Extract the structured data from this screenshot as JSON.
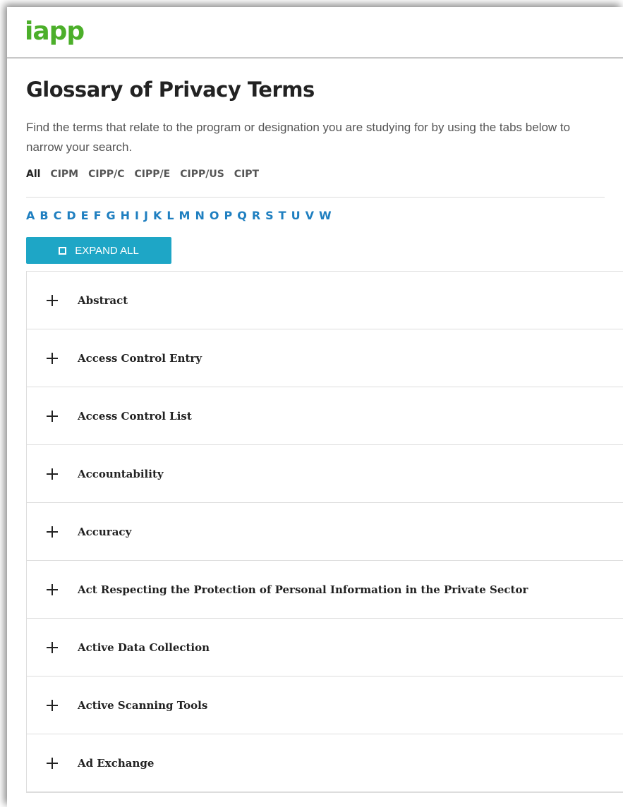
{
  "header": {
    "logo": "iapp"
  },
  "page": {
    "title": "Glossary of Privacy Terms",
    "intro": "Find the terms that relate to the program or designation you are studying for by using the tabs below to narrow your search."
  },
  "tabs": [
    {
      "label": "All",
      "active": true
    },
    {
      "label": "CIPM"
    },
    {
      "label": "CIPP/C"
    },
    {
      "label": "CIPP/E"
    },
    {
      "label": "CIPP/US"
    },
    {
      "label": "CIPT"
    }
  ],
  "letters": [
    "A",
    "B",
    "C",
    "D",
    "E",
    "F",
    "G",
    "H",
    "I",
    "J",
    "K",
    "L",
    "M",
    "N",
    "O",
    "P",
    "Q",
    "R",
    "S",
    "T",
    "U",
    "V",
    "W"
  ],
  "expand_button": {
    "label": "EXPAND ALL",
    "icon": "expand-icon"
  },
  "terms": [
    "Abstract",
    "Access Control Entry",
    "Access Control List",
    "Accountability",
    "Accuracy",
    "Act Respecting the Protection of Personal Information in the Private Sector",
    "Active Data Collection",
    "Active Scanning Tools",
    "Ad Exchange"
  ],
  "colors": {
    "brand": "#4caf2a",
    "letters": "#1f7fc0",
    "button": "#1ea6c6"
  }
}
